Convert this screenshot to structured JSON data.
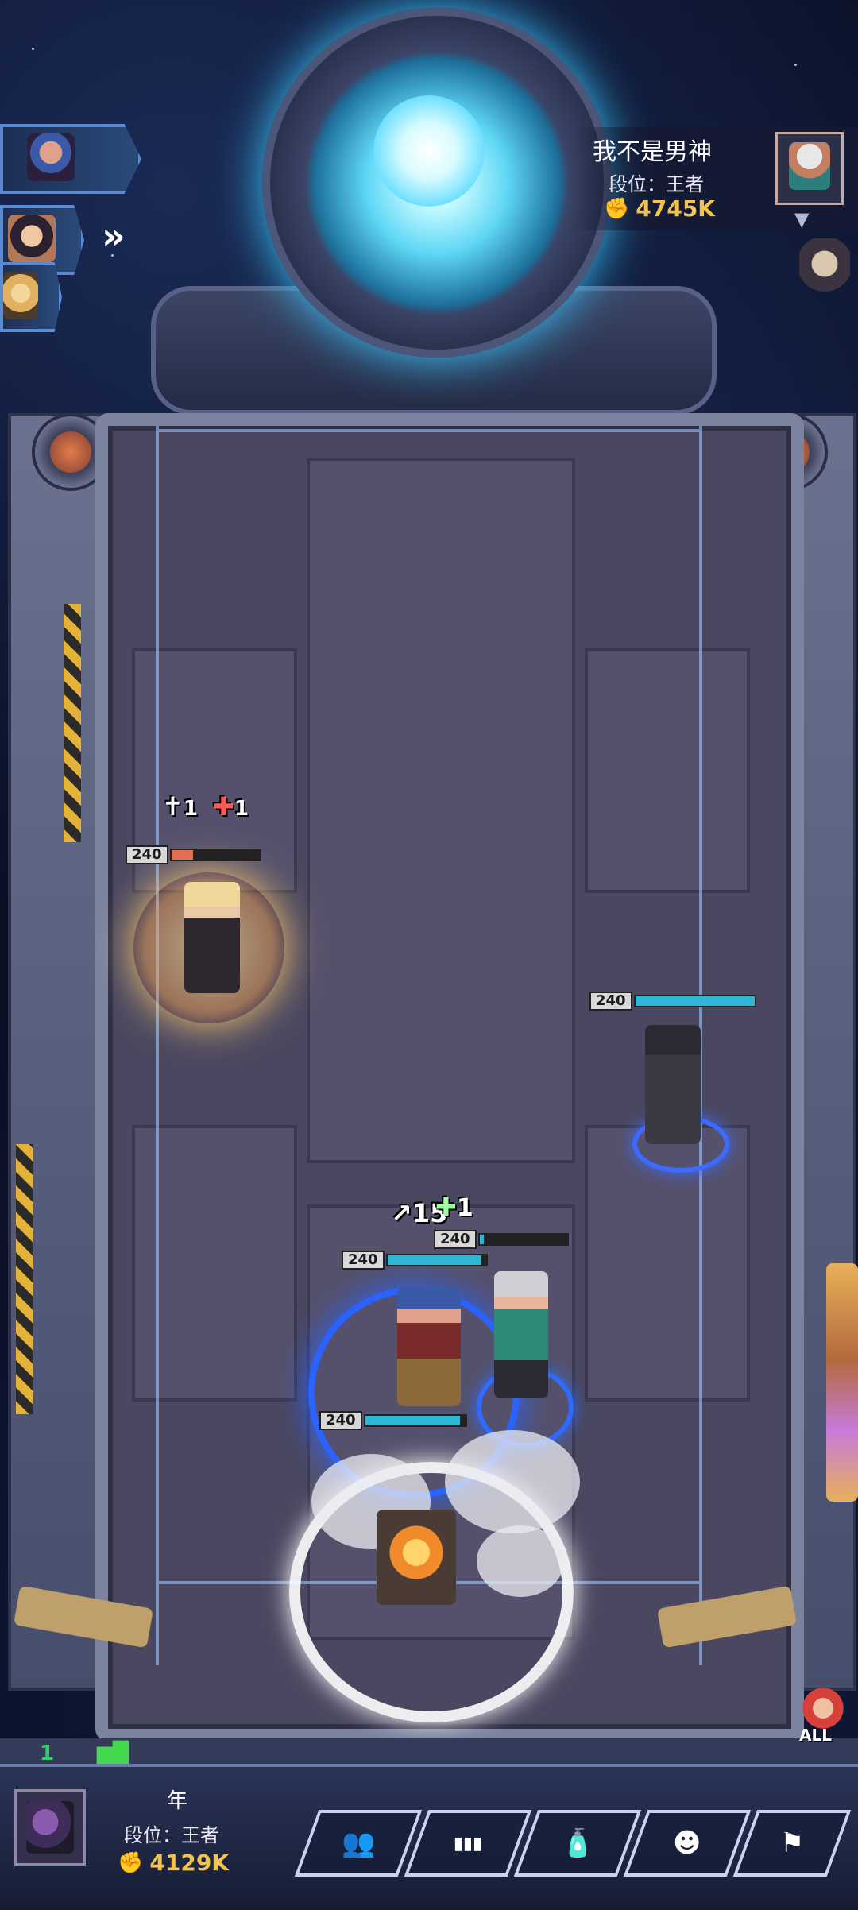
{
  "teammates": [
    {
      "icon": "teammate-archer-icon"
    },
    {
      "icon": "teammate-horned-icon"
    },
    {
      "icon": "teammate-blonde-icon"
    }
  ],
  "expand_icon": "double-chevron-right-icon",
  "opponent": {
    "name": "我不是男神",
    "rank": "段位：王者",
    "power": "4745K",
    "power_icon": "fist-icon"
  },
  "units": [
    {
      "name": "blonde-mage-unit",
      "hp_label": "240",
      "hp_fraction": 0.25,
      "bar_color": "#e26d4f",
      "buffs": [
        {
          "icon": "attack-buff-icon",
          "count": "1"
        },
        {
          "icon": "heal-buff-icon",
          "count": "1"
        }
      ]
    },
    {
      "name": "dark-armored-unit",
      "hp_label": "240",
      "hp_fraction": 1.0,
      "bar_color": "#2fb6d6"
    },
    {
      "name": "archer-unit",
      "hp_label": "240",
      "hp_fraction": 0.95,
      "bar_color": "#2fb6d6",
      "buffs": [
        {
          "icon": "attack-buff-icon",
          "count": "15"
        }
      ]
    },
    {
      "name": "silver-hair-unit",
      "hp_label": "240",
      "hp_fraction": 0.05,
      "bar_color": "#2fb6d6",
      "buffs": [
        {
          "icon": "heal-buff-icon",
          "count": "1"
        }
      ]
    },
    {
      "name": "cannon-unit",
      "hp_label": "240",
      "hp_fraction": 0.95,
      "bar_color": "#2fb6d6"
    }
  ],
  "status": {
    "left_number": "1",
    "all_label": "ALL"
  },
  "player": {
    "name": "年",
    "rank": "段位：王者",
    "power": "4129K",
    "power_icon": "fist-icon"
  },
  "menu": [
    {
      "name": "team-button",
      "icon": "team-list-icon",
      "glyph": "👥"
    },
    {
      "name": "stats-button",
      "icon": "bar-chart-icon",
      "glyph": "▮▮▮"
    },
    {
      "name": "potion-button",
      "icon": "bottle-icon",
      "glyph": "🧴"
    },
    {
      "name": "emote-button",
      "icon": "smiley-icon",
      "glyph": "☻"
    },
    {
      "name": "surrender-button",
      "icon": "flag-icon",
      "glyph": "⚑"
    }
  ],
  "colors": {
    "power_gold": "#f3c44a",
    "hp_teal": "#2fb6d6",
    "hp_orange": "#e26d4f"
  }
}
